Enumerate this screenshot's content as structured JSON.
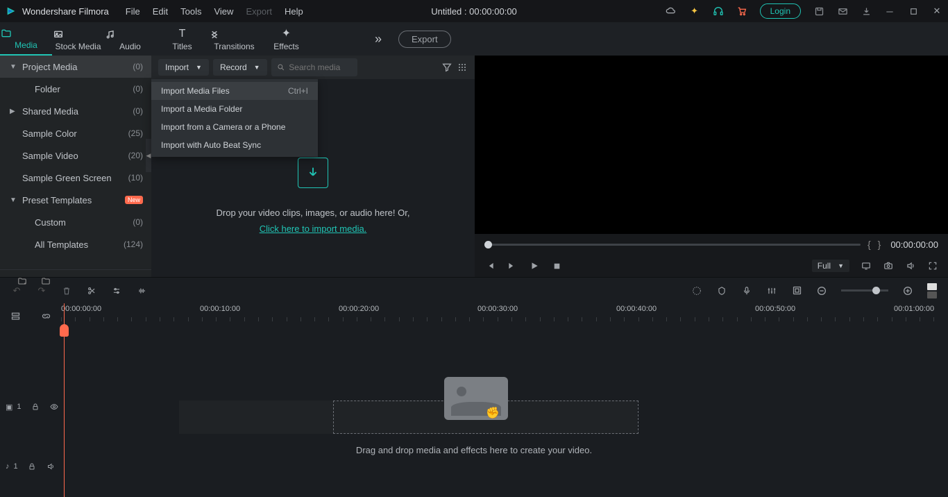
{
  "titlebar": {
    "app_name": "Wondershare Filmora",
    "menus": [
      "File",
      "Edit",
      "Tools",
      "View",
      "Export",
      "Help"
    ],
    "doc_title": "Untitled : 00:00:00:00",
    "login": "Login"
  },
  "tool_tabs": [
    {
      "label": "Media",
      "active": true
    },
    {
      "label": "Stock Media"
    },
    {
      "label": "Audio"
    },
    {
      "label": "Titles"
    },
    {
      "label": "Transitions"
    },
    {
      "label": "Effects"
    }
  ],
  "export_btn": "Export",
  "sidebar": {
    "items": [
      {
        "label": "Project Media",
        "count": "(0)",
        "active": true,
        "caret": "▼"
      },
      {
        "label": "Folder",
        "count": "(0)",
        "indent": 1
      },
      {
        "label": "Shared Media",
        "count": "(0)",
        "caret": "▶"
      },
      {
        "label": "Sample Color",
        "count": "(25)"
      },
      {
        "label": "Sample Video",
        "count": "(20)"
      },
      {
        "label": "Sample Green Screen",
        "count": "(10)"
      },
      {
        "label": "Preset Templates",
        "badge": "New",
        "caret": "▼"
      },
      {
        "label": "Custom",
        "count": "(0)",
        "indent": 1
      },
      {
        "label": "All Templates",
        "count": "(124)",
        "indent": 1
      }
    ]
  },
  "topbar2": {
    "import": "Import",
    "record": "Record",
    "search_placeholder": "Search media"
  },
  "import_menu": [
    {
      "label": "Import Media Files",
      "shortcut": "Ctrl+I"
    },
    {
      "label": "Import a Media Folder"
    },
    {
      "label": "Import from a Camera or a Phone"
    },
    {
      "label": "Import with Auto Beat Sync"
    }
  ],
  "drop": {
    "line1": "Drop your video clips, images, or audio here! Or,",
    "link": "Click here to import media."
  },
  "preview": {
    "timecode": "00:00:00:00",
    "size_label": "Full"
  },
  "timeline": {
    "times": [
      "00:00:00:00",
      "00:00:10:00",
      "00:00:20:00",
      "00:00:30:00",
      "00:00:40:00",
      "00:00:50:00",
      "00:01:00:00"
    ],
    "video_track": "1",
    "audio_track": "1",
    "hint": "Drag and drop media and effects here to create your video."
  }
}
